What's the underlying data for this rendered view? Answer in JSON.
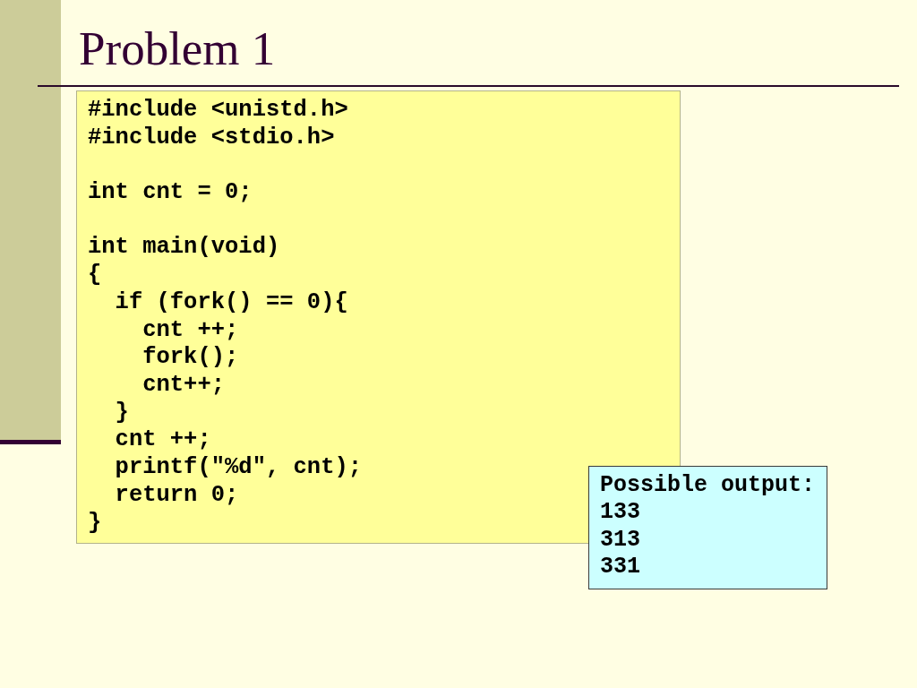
{
  "slide": {
    "title": "Problem 1"
  },
  "code_box": {
    "paragraphs": [
      [
        "#include <unistd.h>",
        "#include <stdio.h>"
      ],
      [
        "int cnt = 0;"
      ],
      [
        "int main(void)",
        "{",
        "  if (fork() == 0){",
        "    cnt ++;",
        "    fork();",
        "    cnt++;",
        "  }",
        "  cnt ++;",
        "  printf(\"%d\", cnt);",
        "  return 0;",
        "}"
      ]
    ]
  },
  "output_box": {
    "heading": "Possible output:",
    "lines": [
      "133",
      "313",
      "331"
    ]
  }
}
